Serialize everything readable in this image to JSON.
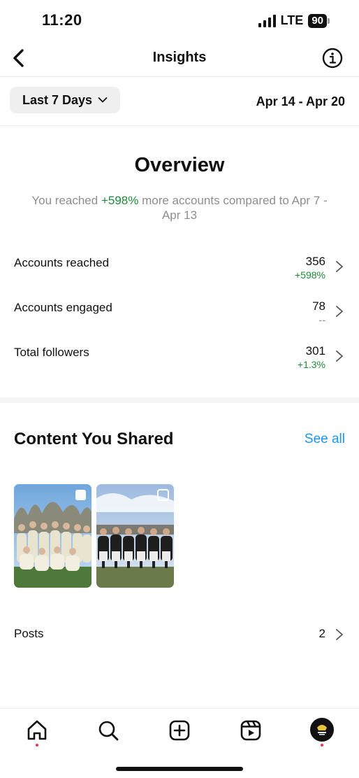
{
  "status_bar": {
    "time": "11:20",
    "network": "LTE",
    "battery": "90"
  },
  "header": {
    "title": "Insights"
  },
  "filter": {
    "range_label": "Last 7 Days",
    "date_range": "Apr 14 - Apr 20"
  },
  "overview": {
    "title": "Overview",
    "desc_prefix": "You reached ",
    "desc_highlight": "+598%",
    "desc_suffix": " more accounts compared to Apr 7 - Apr 13",
    "metrics": [
      {
        "label": "Accounts reached",
        "value": "356",
        "change": "+598%"
      },
      {
        "label": "Accounts engaged",
        "value": "78",
        "change": "--"
      },
      {
        "label": "Total followers",
        "value": "301",
        "change": "+1.3%"
      }
    ]
  },
  "content": {
    "title": "Content You Shared",
    "see_all": "See all",
    "posts_label": "Posts",
    "posts_count": "2"
  },
  "tabs": [
    "home-icon",
    "search-icon",
    "create-icon",
    "reels-icon",
    "profile-avatar"
  ],
  "colors": {
    "positive": "#1f8b3a",
    "link": "#1a95f0",
    "notification": "#ff3040"
  }
}
